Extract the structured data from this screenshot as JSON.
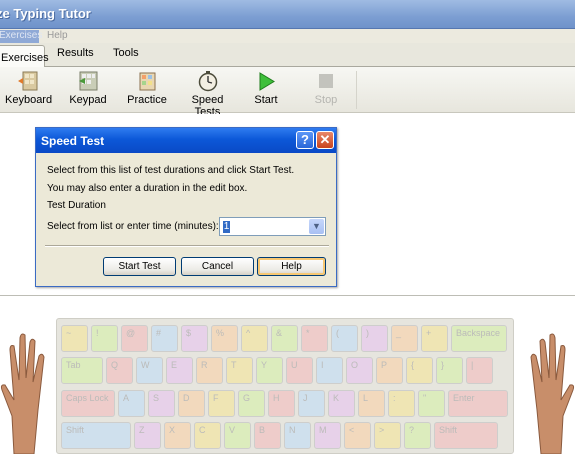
{
  "window": {
    "title": "ze Typing Tutor"
  },
  "menu": {
    "items": [
      "Exercises",
      "Help"
    ]
  },
  "tabs": [
    "Exercises",
    "Results",
    "Tools"
  ],
  "toolbar": {
    "items": [
      "Keyboard",
      "Keypad",
      "Practice",
      "Speed Tests",
      "Start",
      "Stop"
    ]
  },
  "dialog": {
    "title": "Speed Test",
    "line1": "Select from this list of test durations and click Start Test.",
    "line2": "You may also enter a duration in the edit box.",
    "section_label": "Test Duration",
    "field_label": "Select from list or enter time (minutes):",
    "duration_value": "1",
    "buttons": {
      "start": "Start Test",
      "cancel": "Cancel",
      "help": "Help"
    }
  },
  "keyboard": {
    "row1": [
      "~",
      "!",
      "@",
      "#",
      "$",
      "%",
      "^",
      "&",
      "*",
      "(",
      ")",
      "_",
      "+",
      "Backspace"
    ],
    "row2": [
      "Tab",
      "Q",
      "W",
      "E",
      "R",
      "T",
      "Y",
      "U",
      "I",
      "O",
      "P",
      "{",
      "}",
      "|"
    ],
    "row3": [
      "Caps Lock",
      "A",
      "S",
      "D",
      "F",
      "G",
      "H",
      "J",
      "K",
      "L",
      ":",
      "\"",
      "Enter"
    ],
    "row4": [
      "Shift",
      "Z",
      "X",
      "C",
      "V",
      "B",
      "N",
      "M",
      "<",
      ">",
      "?",
      "Shift"
    ]
  },
  "colors": {
    "accent": "#0c58d8",
    "key_colors": [
      "#f4e6a3",
      "#d9efb0",
      "#f2c2c2",
      "#c6def4",
      "#e8c9ee",
      "#f8d5b0"
    ]
  }
}
